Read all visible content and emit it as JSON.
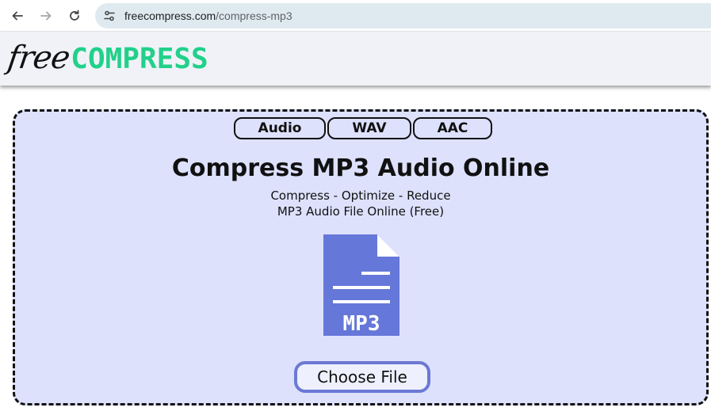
{
  "browser": {
    "url_host": "freecompress.com",
    "url_path": "/compress-mp3"
  },
  "header": {
    "logo_free": "free",
    "logo_compress": "COMPRESS",
    "brand_color": "#21d18a"
  },
  "main": {
    "tabs": [
      {
        "label": "Audio"
      },
      {
        "label": "WAV"
      },
      {
        "label": "AAC"
      }
    ],
    "title": "Compress MP3 Audio Online",
    "subtitle_line1": "Compress - Optimize - Reduce",
    "subtitle_line2": "MP3 Audio File Online (Free)",
    "file_icon_label": "MP3",
    "file_icon_color": "#6577d8",
    "choose_file_label": "Choose File"
  }
}
